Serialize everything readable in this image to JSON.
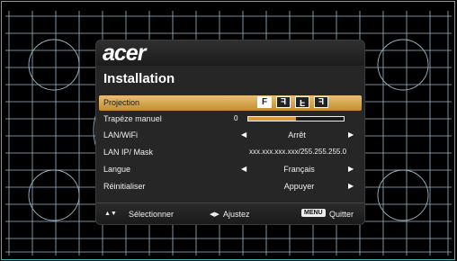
{
  "osd": {
    "logo": "acer",
    "title": "Installation",
    "projection": {
      "label": "Projection",
      "modes": [
        {
          "glyph": "F",
          "name": "front-desktop",
          "active": true
        },
        {
          "glyph": "F",
          "name": "front-ceiling",
          "active": false
        },
        {
          "glyph": "F",
          "name": "rear-desktop",
          "active": false
        },
        {
          "glyph": "F",
          "name": "rear-ceiling",
          "active": false
        }
      ]
    },
    "keystone": {
      "label": "Trapéze manuel",
      "value": "0",
      "fill_fraction": 0.5
    },
    "lan_wifi": {
      "label": "LAN/WiFi",
      "value": "Arrêt"
    },
    "lan_ip": {
      "label": "LAN IP/ Mask",
      "value": "xxx.xxx.xxx.xxx/255.255.255.0"
    },
    "language": {
      "label": "Langue",
      "value": "Français"
    },
    "reset": {
      "label": "Réinitialiser",
      "value": "Appuyer"
    },
    "footer": {
      "select": "Sélectionner",
      "adjust": "Ajustez",
      "menu_key": "MENU",
      "quit": "Quitter"
    }
  },
  "colors": {
    "frame": "#3bb7c0",
    "grid": "#9ab7c4",
    "highlight": "#d6a24e",
    "panel": "#262626"
  }
}
